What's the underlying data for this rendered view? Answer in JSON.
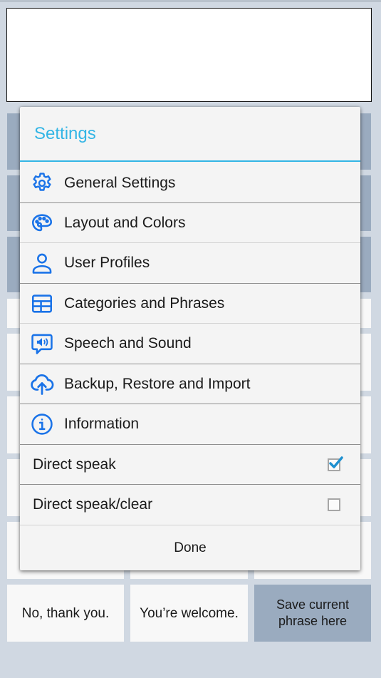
{
  "phrase_box": {
    "value": ""
  },
  "background_grid": {
    "rows": [
      {
        "type": "category",
        "cells": [
          "",
          "",
          ""
        ]
      },
      {
        "type": "category",
        "cells": [
          "",
          "",
          ""
        ]
      },
      {
        "type": "category",
        "cells": [
          "",
          "",
          ""
        ]
      },
      {
        "type": "phrase",
        "cells": [
          "",
          "",
          ""
        ]
      },
      {
        "type": "phrase",
        "cells": [
          "",
          "",
          ""
        ]
      },
      {
        "type": "phrase",
        "cells": [
          "",
          "",
          ""
        ]
      },
      {
        "type": "phrase",
        "cells": [
          "",
          "",
          ""
        ]
      },
      {
        "type": "phrase",
        "cells": [
          "",
          "",
          ""
        ]
      }
    ],
    "bottom_row": [
      {
        "label": "No, thank you."
      },
      {
        "label": "You’re welcome."
      },
      {
        "label": "Save current phrase here"
      }
    ]
  },
  "dialog": {
    "title": "Settings",
    "accent_color": "#33b5e5",
    "icon_color": "#1a73e8",
    "menu_items": [
      {
        "label": "General Settings",
        "icon": "gear-icon"
      },
      {
        "label": "Layout and Colors",
        "icon": "palette-icon"
      },
      {
        "label": "User Profiles",
        "icon": "user-icon"
      },
      {
        "label": "Categories and Phrases",
        "icon": "grid-icon"
      },
      {
        "label": "Speech and Sound",
        "icon": "speech-bubble-speaker-icon"
      },
      {
        "label": "Backup, Restore and Import",
        "icon": "cloud-upload-icon"
      },
      {
        "label": "Information",
        "icon": "info-icon"
      }
    ],
    "toggles": [
      {
        "label": "Direct speak",
        "checked": true
      },
      {
        "label": "Direct speak/clear",
        "checked": false
      }
    ],
    "done_label": "Done"
  }
}
